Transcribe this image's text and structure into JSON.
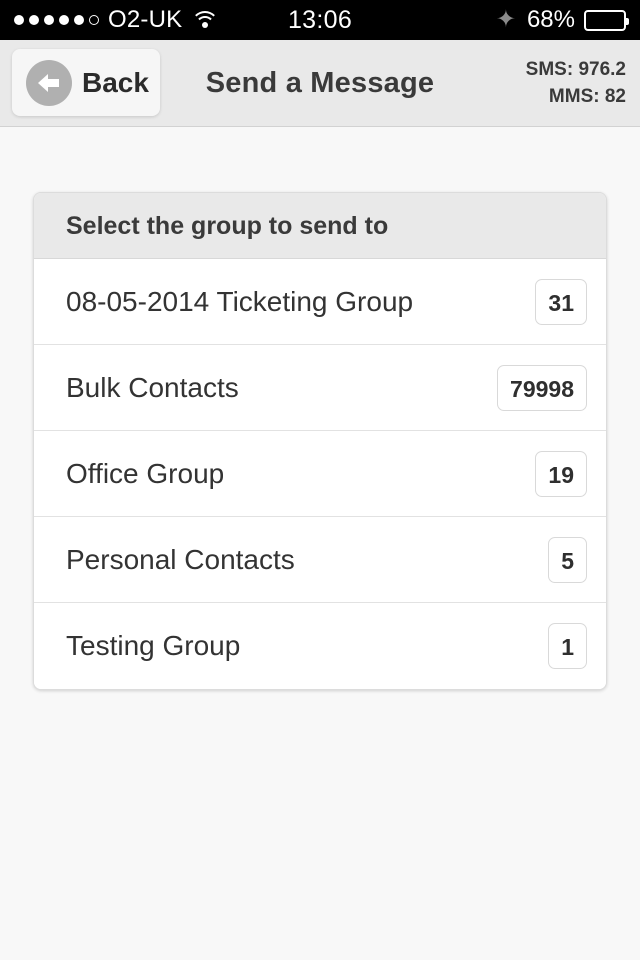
{
  "status_bar": {
    "signal_filled": 5,
    "signal_empty": 1,
    "carrier": "O2-UK",
    "wifi_icon": "wifi-icon",
    "time": "13:06",
    "bluetooth_icon": "bluetooth-icon",
    "battery_percent": "68%",
    "battery_level": 68,
    "background": "#000000",
    "foreground": "#ffffff"
  },
  "header": {
    "back_label": "Back",
    "back_icon": "arrow-left-icon",
    "title": "Send a Message",
    "sms_credit": "SMS: 976.2",
    "mms_credit": "MMS: 82",
    "background": "#e9e9e9"
  },
  "panel": {
    "header": "Select the group to send to",
    "rows": [
      {
        "name": "08-05-2014 Ticketing Group",
        "count": "31"
      },
      {
        "name": "Bulk Contacts",
        "count": "79998"
      },
      {
        "name": "Office Group",
        "count": "19"
      },
      {
        "name": "Personal Contacts",
        "count": "5"
      },
      {
        "name": "Testing Group",
        "count": "1"
      }
    ]
  },
  "colors": {
    "page_background": "#f8f8f8",
    "panel_background": "#ffffff",
    "panel_header_background": "#e9e9e9",
    "text_primary": "#333333",
    "divider": "#e2e2e2",
    "back_circle": "#b0b0b0"
  }
}
